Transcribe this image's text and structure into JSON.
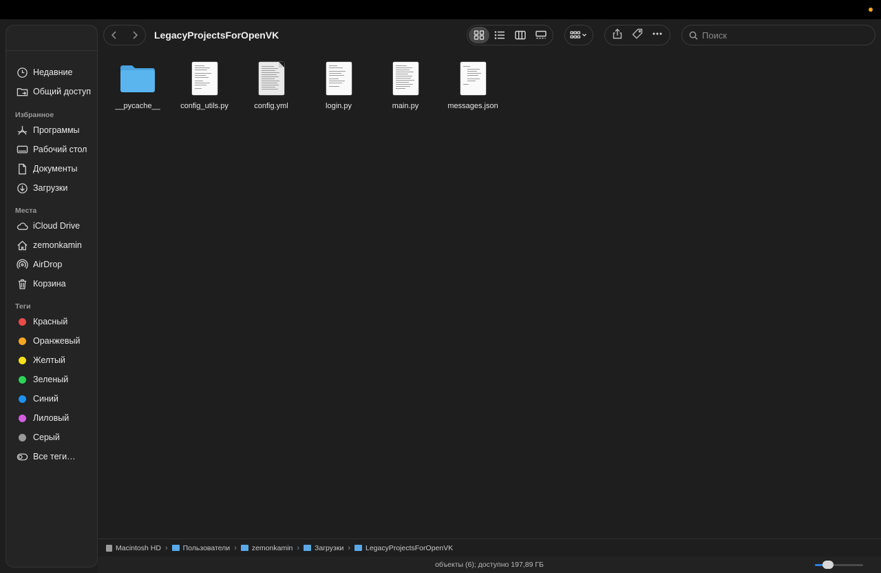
{
  "window": {
    "title": "LegacyProjectsForOpenVK"
  },
  "sidebar": {
    "top_items": [
      {
        "label": "Недавние",
        "icon": "clock-icon"
      },
      {
        "label": "Общий доступ",
        "icon": "shared-folder-icon"
      }
    ],
    "favorites_header": "Избранное",
    "favorites": [
      {
        "label": "Программы",
        "icon": "applications-icon"
      },
      {
        "label": "Рабочий стол",
        "icon": "desktop-icon"
      },
      {
        "label": "Документы",
        "icon": "document-icon"
      },
      {
        "label": "Загрузки",
        "icon": "downloads-icon"
      }
    ],
    "locations_header": "Места",
    "locations": [
      {
        "label": "iCloud Drive",
        "icon": "cloud-icon"
      },
      {
        "label": "zemonkamin",
        "icon": "home-icon"
      },
      {
        "label": "AirDrop",
        "icon": "airdrop-icon"
      },
      {
        "label": "Корзина",
        "icon": "trash-icon"
      }
    ],
    "tags_header": "Теги",
    "tags": [
      {
        "label": "Красный",
        "color": "#ec4a4a"
      },
      {
        "label": "Оранжевый",
        "color": "#f5a623"
      },
      {
        "label": "Желтый",
        "color": "#f4e11b"
      },
      {
        "label": "Зеленый",
        "color": "#2fd158"
      },
      {
        "label": "Синий",
        "color": "#1e90f0"
      },
      {
        "label": "Лиловый",
        "color": "#d35ee0"
      },
      {
        "label": "Серый",
        "color": "#9a9a9a"
      }
    ],
    "all_tags": "Все теги…"
  },
  "toolbar": {
    "search_placeholder": "Поиск",
    "view_modes": [
      "icons",
      "list",
      "columns",
      "gallery"
    ],
    "active_view": "icons"
  },
  "files": [
    {
      "name": "__pycache__",
      "kind": "folder"
    },
    {
      "name": "config_utils.py",
      "kind": "code"
    },
    {
      "name": "config.yml",
      "kind": "text"
    },
    {
      "name": "login.py",
      "kind": "code"
    },
    {
      "name": "main.py",
      "kind": "code"
    },
    {
      "name": "messages.json",
      "kind": "code"
    }
  ],
  "pathbar": [
    {
      "label": "Macintosh HD",
      "kind": "disk"
    },
    {
      "label": "Пользователи",
      "kind": "folder"
    },
    {
      "label": "zemonkamin",
      "kind": "folder"
    },
    {
      "label": "Загрузки",
      "kind": "folder"
    },
    {
      "label": "LegacyProjectsForOpenVK",
      "kind": "folder"
    }
  ],
  "status": "объекты (6); доступно 197,89 ГБ",
  "icon_size_slider": 0.27,
  "accent": "#2f7fe0",
  "folder_color": "#5ab4ee"
}
